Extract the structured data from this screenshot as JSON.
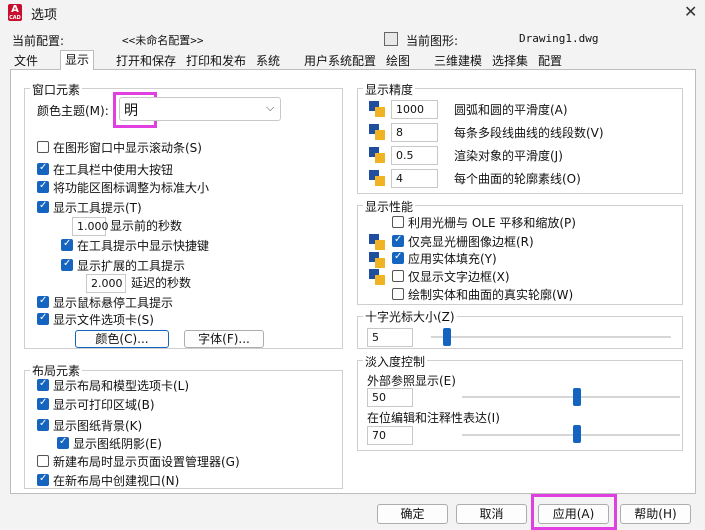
{
  "window": {
    "title": "选项",
    "close": "✕",
    "app_icon": "A",
    "app_icon_sub": "CAD"
  },
  "header": {
    "current_profile_label": "当前配置:",
    "current_profile_value": "<<未命名配置>>",
    "current_drawing_label": "当前图形:",
    "current_drawing_value": "Drawing1.dwg"
  },
  "tabs": [
    "文件",
    "显示",
    "打开和保存",
    "打印和发布",
    "系统",
    "用户系统配置",
    "绘图",
    "三维建模",
    "选择集",
    "配置"
  ],
  "window_elements": {
    "title": "窗口元素",
    "color_theme_label": "颜色主题(M):",
    "color_theme_value": "明",
    "options": [
      {
        "label": "在图形窗口中显示滚动条(S)",
        "checked": false
      },
      {
        "label": "在工具栏中使用大按钮",
        "checked": true
      },
      {
        "label": "将功能区图标调整为标准大小",
        "checked": true
      },
      {
        "label": "显示工具提示(T)",
        "checked": true
      }
    ],
    "delay_value": "1.000",
    "delay_label": "显示前的秒数",
    "shortcut_label": "在工具提示中显示快捷键",
    "extended_label": "显示扩展的工具提示",
    "extended_delay_value": "2.000",
    "extended_delay_label": "延迟的秒数",
    "rollover_label": "显示鼠标悬停工具提示",
    "filetabs_label": "显示文件选项卡(S)",
    "colors_button": "颜色(C)...",
    "fonts_button": "字体(F)..."
  },
  "layout_elements": {
    "title": "布局元素",
    "options": [
      {
        "label": "显示布局和模型选项卡(L)",
        "checked": true
      },
      {
        "label": "显示可打印区域(B)",
        "checked": true
      },
      {
        "label": "显示图纸背景(K)",
        "checked": true
      },
      {
        "label": "显示图纸阴影(E)",
        "checked": true
      },
      {
        "label": "新建布局时显示页面设置管理器(G)",
        "checked": false
      },
      {
        "label": "在新布局中创建视口(N)",
        "checked": true
      }
    ]
  },
  "display_resolution": {
    "title": "显示精度",
    "rows": [
      {
        "value": "1000",
        "label": "圆弧和圆的平滑度(A)"
      },
      {
        "value": "8",
        "label": "每条多段线曲线的线段数(V)"
      },
      {
        "value": "0.5",
        "label": "渲染对象的平滑度(J)"
      },
      {
        "value": "4",
        "label": "每个曲面的轮廓素线(O)"
      }
    ]
  },
  "display_performance": {
    "title": "显示性能",
    "options": [
      {
        "label": "利用光栅与 OLE 平移和缩放(P)",
        "checked": false
      },
      {
        "label": "仅亮显光栅图像边框(R)",
        "checked": true
      },
      {
        "label": "应用实体填充(Y)",
        "checked": true
      },
      {
        "label": "仅显示文字边框(X)",
        "checked": false
      },
      {
        "label": "绘制实体和曲面的真实轮廓(W)",
        "checked": false
      }
    ]
  },
  "crosshair": {
    "title": "十字光标大小(Z)",
    "value": "5"
  },
  "fade_control": {
    "title": "淡入度控制",
    "xref_label": "外部参照显示(E)",
    "xref_value": "50",
    "inplace_label": "在位编辑和注释性表达(I)",
    "inplace_value": "70"
  },
  "footer": {
    "ok": "确定",
    "cancel": "取消",
    "apply": "应用(A)",
    "help": "帮助(H)"
  },
  "colors": {
    "accent": "#1565c0",
    "highlight": "#e040e0",
    "app_red": "#c8102e"
  }
}
